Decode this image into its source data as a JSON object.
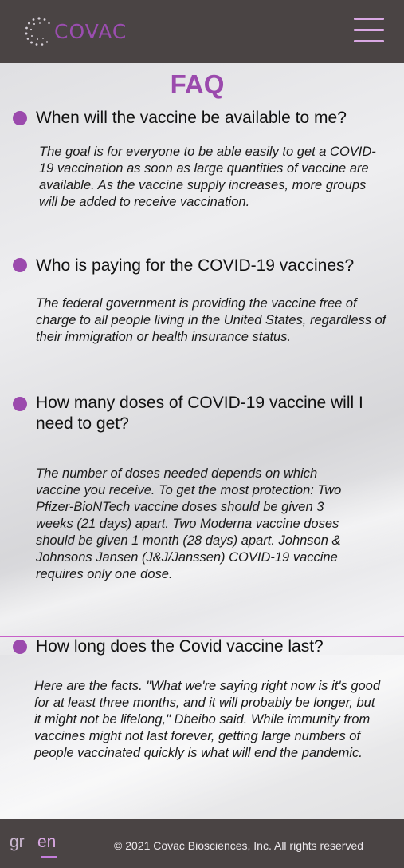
{
  "header": {
    "logo_text": "COVAC",
    "logo_icon": "dotted-circle-logo-icon",
    "menu_icon": "hamburger-menu-icon"
  },
  "page": {
    "title": "FAQ"
  },
  "faq": [
    {
      "question": "When will the vaccine be available to me?",
      "answer": "The goal is for everyone to be able easily to get a COVID-19 vaccination as soon as large quantities of vaccine are available. As the vaccine supply increases, more groups will be added to receive vaccination."
    },
    {
      "question": "Who is paying for the COVID-19 vaccines?",
      "answer": "The federal government is providing the vaccine free of charge to all people living in the United States, regardless of their immigration or health insurance status."
    },
    {
      "question": "How many doses of COVID-19 vaccine will I need to get?",
      "answer": "The number of doses needed depends on which vaccine you receive. To get the most protection: Two Pfizer-BioNTech vaccine doses should be given 3 weeks (21 days) apart. Two Moderna vaccine doses should be given 1 month (28 days) apart. Johnson & Johnsons Jansen (J&J/Janssen) COVID-19 vaccine requires only one dose."
    },
    {
      "question": "How long does the Covid vaccine last?",
      "answer": "Here are the facts. \"What we're saying right now is it's good for at least three months, and it will probably be longer, but it might not be lifelong,\" Dbeibo said. While immunity from vaccines might not last forever, getting large numbers of people vaccinated quickly is what will end the pandemic."
    }
  ],
  "footer": {
    "lang_gr": "gr",
    "lang_en": "en",
    "active_lang": "en",
    "copyright": "© 2021 Covac Biosciences, Inc. All rights reserved"
  },
  "colors": {
    "header_bg": "#4a4444",
    "accent": "#9b4aad",
    "menu_lines": "#d9a8e3",
    "divider": "#c860c8"
  }
}
